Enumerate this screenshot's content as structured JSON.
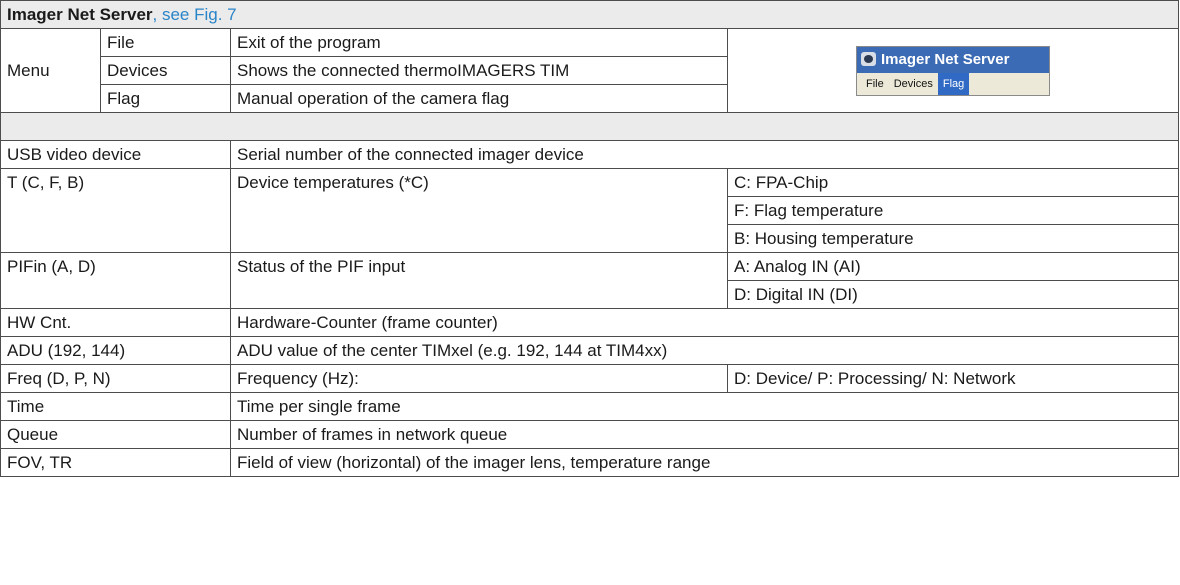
{
  "header": {
    "title": "Imager Net Server",
    "ref": ", see Fig. 7"
  },
  "menu": {
    "label": "Menu",
    "items": [
      {
        "name": "File",
        "desc": "Exit of the program"
      },
      {
        "name": "Devices",
        "desc": "Shows the connected thermoIMAGERS TIM"
      },
      {
        "name": "Flag",
        "desc": "Manual operation of the camera flag"
      }
    ]
  },
  "mini_window": {
    "title": "Imager Net Server",
    "menu": [
      "File",
      "Devices",
      "Flag"
    ],
    "selected": "Flag",
    "title_color": "#3b6bb4",
    "menu_bg": "#ece9d8"
  },
  "rows": {
    "usb": {
      "label": "USB video device",
      "desc": "Serial number of the connected imager device"
    },
    "temp": {
      "label": "T (C, F, B)",
      "desc": "Device temperatures (*C)",
      "subs": [
        "C: FPA-Chip",
        "F: Flag temperature",
        "B: Housing temperature"
      ]
    },
    "pif": {
      "label": "PIFin (A, D)",
      "desc": "Status of the PIF input",
      "subs": [
        "A: Analog IN (AI)",
        "D: Digital IN (DI)"
      ]
    },
    "hw": {
      "label": "HW Cnt.",
      "desc": "Hardware-Counter (frame counter)"
    },
    "adu": {
      "label": "ADU (192, 144)",
      "desc": "ADU value of the center TIMxel (e.g. 192, 144 at TIM4xx)"
    },
    "freq": {
      "label": "Freq (D, P, N)",
      "desc": "Frequency (Hz):",
      "sub": "D: Device/ P: Processing/ N: Network"
    },
    "time": {
      "label": "Time",
      "desc": "Time per single frame"
    },
    "queue": {
      "label": "Queue",
      "desc": "Number of frames in network queue"
    },
    "fov": {
      "label": "FOV, TR",
      "desc": "Field of view (horizontal) of the imager lens, temperature range"
    }
  },
  "colors": {
    "header_bg": "#ebebeb",
    "link": "#2a84c8",
    "border": "#4d4d4d"
  }
}
